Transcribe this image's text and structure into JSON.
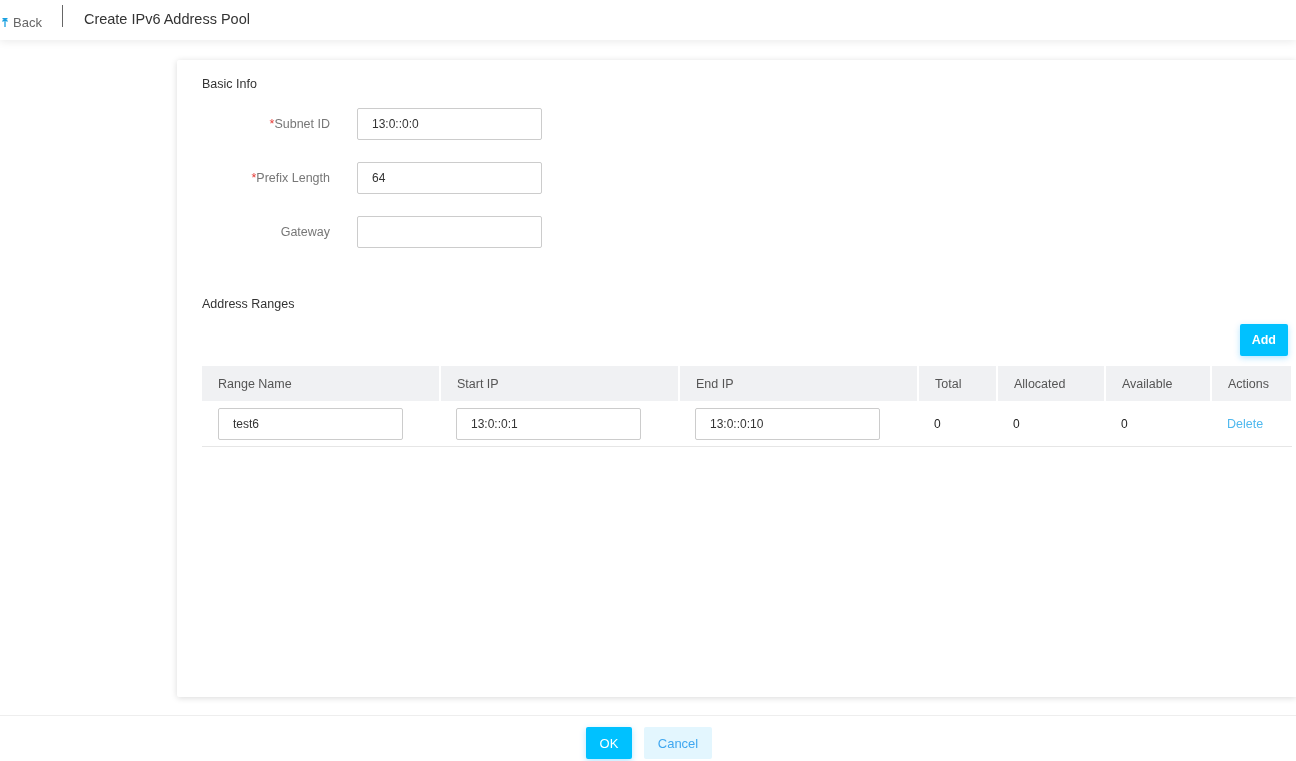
{
  "header": {
    "back": "Back",
    "title": "Create IPv6 Address Pool"
  },
  "basic_info": {
    "title": "Basic Info",
    "fields": [
      {
        "label": "Subnet ID",
        "required_mark": "*",
        "value": "13:0::0:0"
      },
      {
        "label": "Prefix Length",
        "required_mark": "*",
        "value": "64"
      },
      {
        "label": "Gateway"
      }
    ]
  },
  "address_ranges": {
    "title": "Address Ranges",
    "add_button": "Add",
    "table": {
      "columns": [
        "Range Name",
        "Start IP",
        "End IP",
        "Total",
        "Allocated",
        "Available",
        "Actions"
      ],
      "rows": [
        {
          "range_name": "test6",
          "start_ip": "13:0::0:1",
          "end_ip": "13:0::0:10",
          "total": "0",
          "allocated": "0",
          "available": "0",
          "action": "Delete"
        }
      ]
    }
  },
  "footer": {
    "buttons": [
      {
        "label": "OK",
        "kind": "primary"
      },
      {
        "label": "Cancel",
        "kind": "secondary"
      }
    ]
  }
}
